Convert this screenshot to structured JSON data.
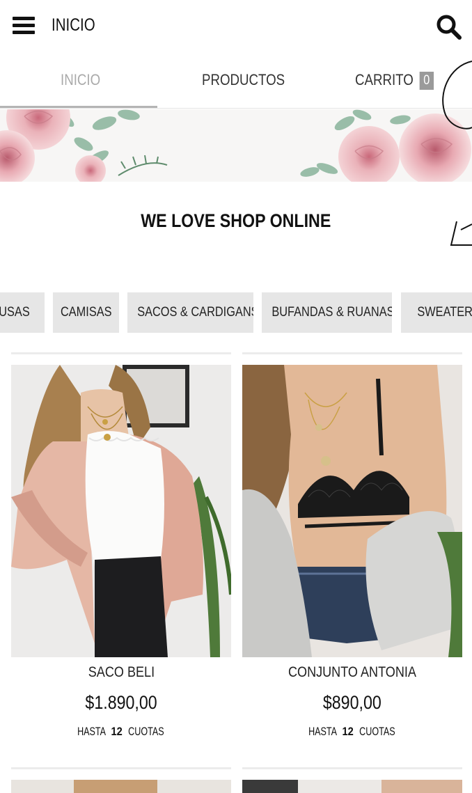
{
  "header": {
    "title": "INICIO"
  },
  "nav": {
    "tabs": [
      {
        "label": "INICIO",
        "active": true
      },
      {
        "label": "PRODUCTOS",
        "active": false
      },
      {
        "label": "CARRITO",
        "active": false
      }
    ],
    "cart_count": "0"
  },
  "slogan": "WE LOVE SHOP ONLINE",
  "categories": [
    "BLUSAS",
    "CAMISAS",
    "SACOS & CARDIGANS",
    "BUFANDAS & RUANAS",
    "SWEATERS"
  ],
  "products": [
    {
      "name": "SACO BELI",
      "price": "$1.890,00",
      "installments_prefix": "HASTA",
      "installments_number": "12",
      "installments_suffix": "CUOTAS"
    },
    {
      "name": "CONJUNTO ANTONIA",
      "price": "$890,00",
      "installments_prefix": "HASTA",
      "installments_number": "12",
      "installments_suffix": "CUOTAS"
    }
  ],
  "colors": {
    "chip_bg": "#e6e6e6",
    "cart_badge": "#9a9a9a",
    "active_tab": "#aaaaaa"
  },
  "icons": [
    "menu-icon",
    "search-icon"
  ]
}
